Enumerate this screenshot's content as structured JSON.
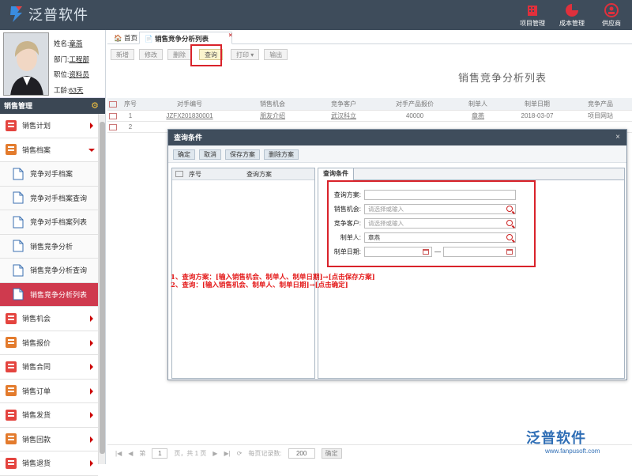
{
  "brand": {
    "name": "泛普软件"
  },
  "top_tools": [
    {
      "label": "项目管理",
      "icon": "building-icon",
      "color": "#e0303c"
    },
    {
      "label": "成本管理",
      "icon": "pie-chart-icon",
      "color": "#e0303c"
    },
    {
      "label": "供应商",
      "icon": "supplier-icon",
      "color": "#e0303c"
    }
  ],
  "profile": {
    "name_label": "姓名:",
    "name": "章燕",
    "dept_label": "部门:",
    "dept": "工程部",
    "position_label": "职位:",
    "position": "资料员",
    "tenure_label": "工龄:",
    "tenure": "63天"
  },
  "sidebar": {
    "section": "销售管理",
    "items": [
      {
        "label": "销售计划",
        "type": "parent",
        "icon": "calendar-list-icon"
      },
      {
        "label": "销售档案",
        "type": "parent-open",
        "icon": "archive-icon"
      },
      {
        "label": "竞争对手档案",
        "type": "sub",
        "icon": "document-icon"
      },
      {
        "label": "竞争对手档案查询",
        "type": "sub",
        "icon": "document-icon"
      },
      {
        "label": "竞争对手档案列表",
        "type": "sub",
        "icon": "document-icon"
      },
      {
        "label": "销售竞争分析",
        "type": "sub",
        "icon": "document-icon"
      },
      {
        "label": "销售竞争分析查询",
        "type": "sub",
        "icon": "document-icon"
      },
      {
        "label": "销售竞争分析列表",
        "type": "sub-active",
        "icon": "document-icon"
      },
      {
        "label": "销售机会",
        "type": "parent",
        "icon": "target-icon"
      },
      {
        "label": "销售报价",
        "type": "parent",
        "icon": "price-tag-icon"
      },
      {
        "label": "销售合同",
        "type": "parent",
        "icon": "contract-icon"
      },
      {
        "label": "销售订单",
        "type": "parent",
        "icon": "order-icon"
      },
      {
        "label": "销售发货",
        "type": "parent",
        "icon": "airplane-icon"
      },
      {
        "label": "销售回款",
        "type": "parent",
        "icon": "payment-icon"
      },
      {
        "label": "销售退货",
        "type": "parent",
        "icon": "return-icon"
      }
    ]
  },
  "tabs": {
    "home": "首页",
    "current": "销售竞争分析列表",
    "close": "×"
  },
  "toolbar": {
    "add": "新增",
    "edit": "修改",
    "delete": "删除",
    "query": "查询",
    "print": "打印",
    "export": "输出"
  },
  "list_title": "销售竞争分析列表",
  "grid": {
    "columns": [
      "序号",
      "对手编号",
      "销售机会",
      "竞争客户",
      "对手产品报价",
      "制单人",
      "制单日期",
      "竞争产品"
    ],
    "rows": [
      [
        "1",
        "JZFX201830001",
        "朋友介绍",
        "武汉科立",
        "40000",
        "章燕",
        "2018-03-07",
        "项目网站"
      ],
      [
        "2",
        "",
        "",
        "",
        "",
        "",
        "",
        ""
      ]
    ]
  },
  "dialog": {
    "title": "查询条件",
    "close": "×",
    "buttons": {
      "ok": "确定",
      "cancel": "取消",
      "save": "保存方案",
      "delete": "删除方案"
    },
    "left_cols": [
      "序号",
      "查询方案"
    ],
    "right_tab": "查询条件",
    "fields": {
      "scheme_label": "查询方案:",
      "opportunity_label": "销售机会:",
      "opportunity_placeholder": "请选择或输入",
      "customer_label": "竞争客户:",
      "customer_placeholder": "请选择或输入",
      "maker_label": "制单人:",
      "maker_value": "章燕",
      "date_label": "制单日期:",
      "date_sep": "—"
    }
  },
  "notes": [
    "1、查询方案：[输入销售机会、制单人、制单日期]→[点击保存方案]",
    "2、查询：[输入销售机会、制单人、制单日期]→[点击确定]"
  ],
  "pager": {
    "page_label": "第",
    "page": "1",
    "of_label": "页，共 1 页",
    "size_label": "每页记录数:",
    "size": "200",
    "ok": "确定"
  },
  "watermark": {
    "name": "泛普软件",
    "url": "www.fanpusoft.com"
  },
  "colors": {
    "topbar": "#3e4c5b",
    "active": "#cf3a4e",
    "highlight": "#d9222a"
  }
}
